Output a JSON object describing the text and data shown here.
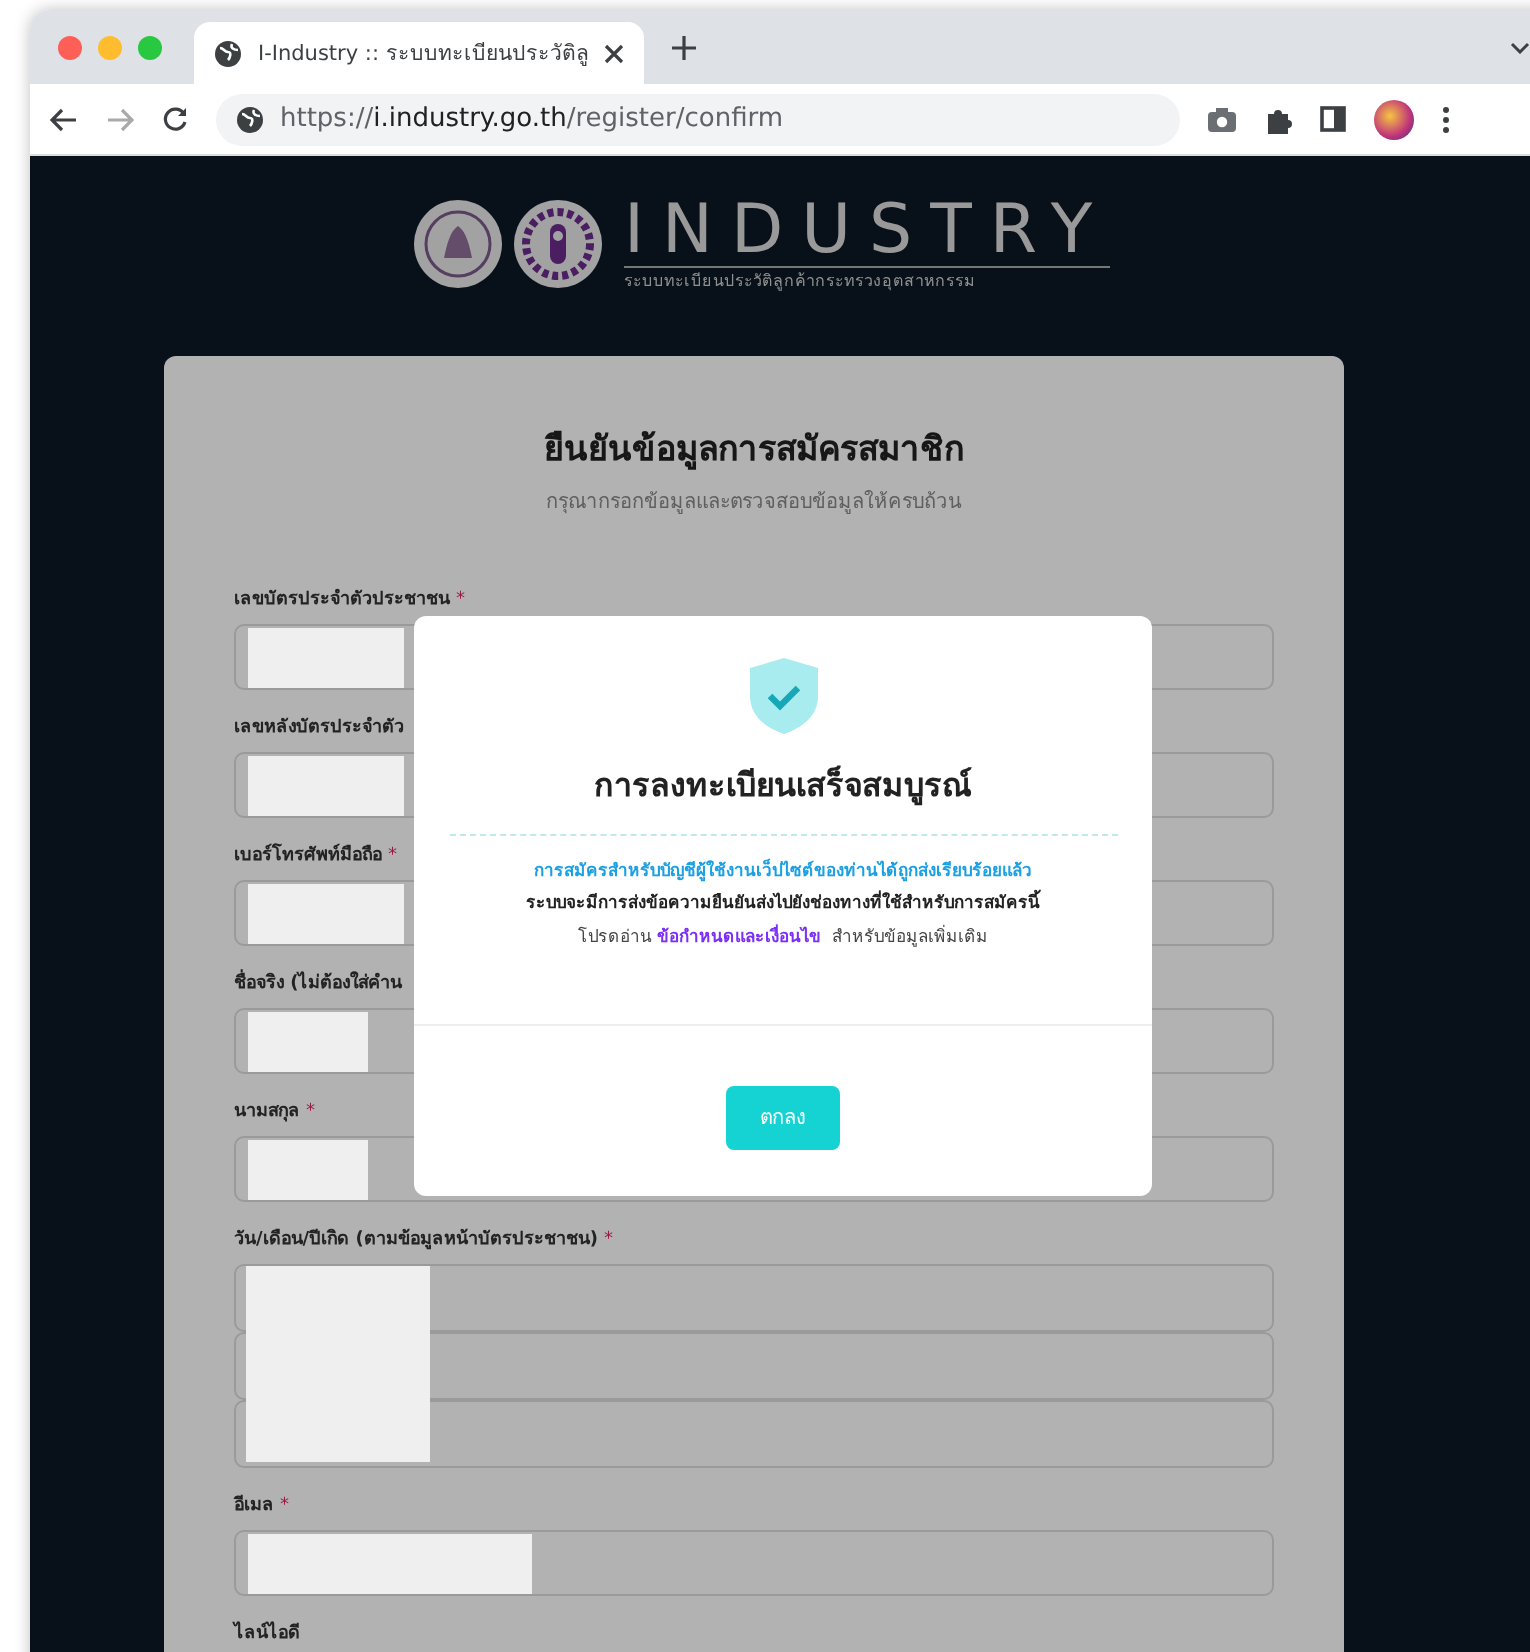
{
  "browser": {
    "tab_title": "I-Industry :: ระบบทะเบียนประวัติลู",
    "url_scheme": "https://",
    "url_host": "i.industry.go.th",
    "url_path": "/register/confirm"
  },
  "header": {
    "logo_text": "INDUSTRY",
    "logo_subtitle": "ระบบทะเบียนประวัติลูกค้ากระทรวงอุตสาหกรรม"
  },
  "form": {
    "title": "ยืนยันข้อมูลการสมัครสมาชิก",
    "subtitle": "กรุณากรอกข้อมูลและตรวจสอบข้อมูลให้ครบถ้วน",
    "fields": [
      {
        "kind": "text",
        "label": "เลขบัตรประจำตัวประชาชน",
        "required_mark": "*"
      },
      {
        "kind": "text",
        "label": "เลขหลังบัตรประจำตัว"
      },
      {
        "kind": "text",
        "label": "เบอร์โทรศัพท์มือถือ",
        "required_mark": "*"
      },
      {
        "kind": "text",
        "label": "ชื่อจริง (ไม่ต้องใส่คำน"
      },
      {
        "kind": "text",
        "label": "นามสกุล",
        "required_mark": "*"
      },
      {
        "kind": "date",
        "label": "วัน/เดือน/ปีเกิด (ตามข้อมูลหน้าบัตรประชาชน)",
        "required_mark": "*"
      },
      {
        "kind": "text",
        "label": "อีเมล",
        "required_mark": "*"
      },
      {
        "kind": "label",
        "label": "ไลน์ไอดี"
      }
    ]
  },
  "modal": {
    "title": "การลงทะเบียนเสร็จสมบูรณ์",
    "message_1": "การสมัครสำหรับบัญชีผู้ใช้งานเว็ปไซต์ของท่านได้ถูกส่งเรียบร้อยแล้ว",
    "message_2": "ระบบจะมีการส่งข้อความยืนยันส่งไปยังช่องทางที่ใช้สำหรับการสมัครนี้",
    "message_3_before": "โปรดอ่าน",
    "message_3_link": "ข้อกำหนดและเงื่อนไข",
    "message_3_after": "สำหรับข้อมูลเพิ่มเติม",
    "button": "ตกลง"
  }
}
